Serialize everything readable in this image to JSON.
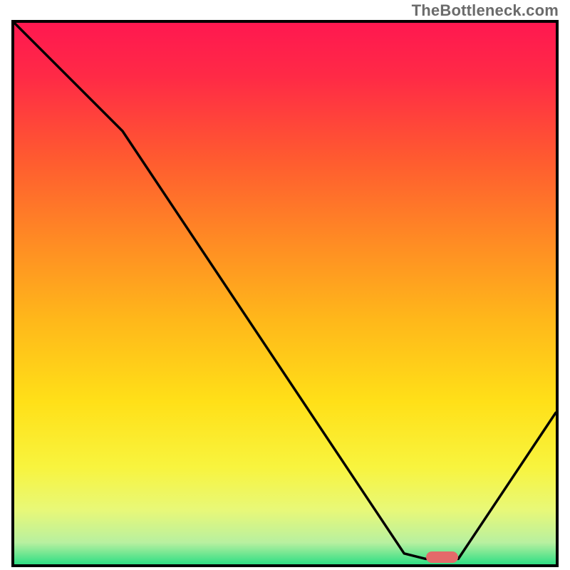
{
  "watermark": "TheBottleneck.com",
  "chart_data": {
    "type": "line",
    "title": "",
    "xlabel": "",
    "ylabel": "",
    "xlim": [
      0,
      100
    ],
    "ylim": [
      0,
      100
    ],
    "grid": false,
    "series": [
      {
        "name": "bottleneck-curve",
        "x": [
          0,
          20,
          72,
          76,
          82,
          100
        ],
        "values": [
          100,
          80,
          2,
          1,
          1,
          28
        ]
      }
    ],
    "optimum_band_x": [
      76,
      82
    ],
    "gradient_stops": [
      {
        "pos": 0.0,
        "color": "#ff1850"
      },
      {
        "pos": 0.1,
        "color": "#ff2a46"
      },
      {
        "pos": 0.25,
        "color": "#ff5a30"
      },
      {
        "pos": 0.4,
        "color": "#ff8a24"
      },
      {
        "pos": 0.55,
        "color": "#ffb81a"
      },
      {
        "pos": 0.7,
        "color": "#ffe018"
      },
      {
        "pos": 0.82,
        "color": "#f8f43e"
      },
      {
        "pos": 0.9,
        "color": "#e8f878"
      },
      {
        "pos": 0.96,
        "color": "#b8f0a0"
      },
      {
        "pos": 1.0,
        "color": "#2fde84"
      }
    ]
  }
}
